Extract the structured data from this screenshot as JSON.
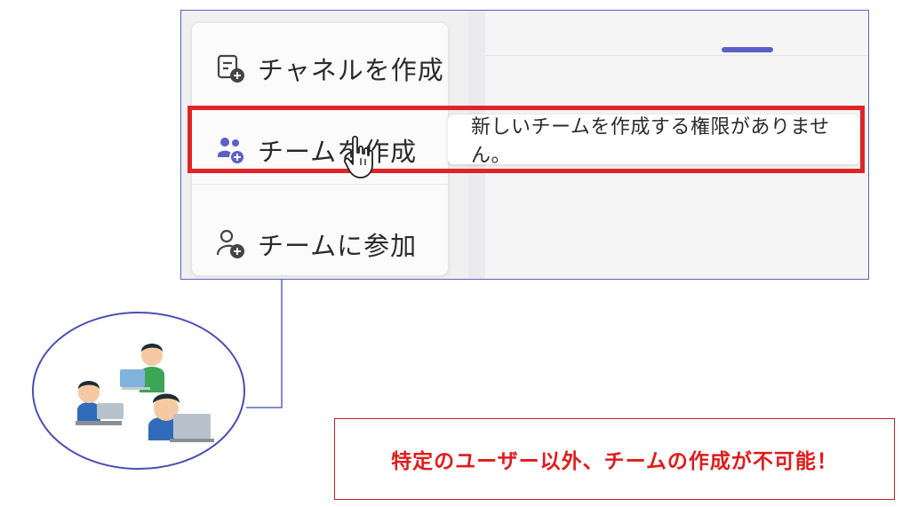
{
  "menu": {
    "items": [
      {
        "label": "チャネルを作成",
        "icon": "channel-add-icon"
      },
      {
        "label": "チームを作成",
        "icon": "team-add-icon"
      },
      {
        "label": "チームに参加",
        "icon": "person-add-icon"
      }
    ]
  },
  "tooltip": {
    "text": "新しいチームを作成する権限がありません。"
  },
  "note": {
    "text": "特定のユーザー以外、チームの作成が不可能！"
  },
  "colors": {
    "accent": "#5b5fc7",
    "highlight": "#e02327",
    "note_text": "#e01b1b"
  }
}
